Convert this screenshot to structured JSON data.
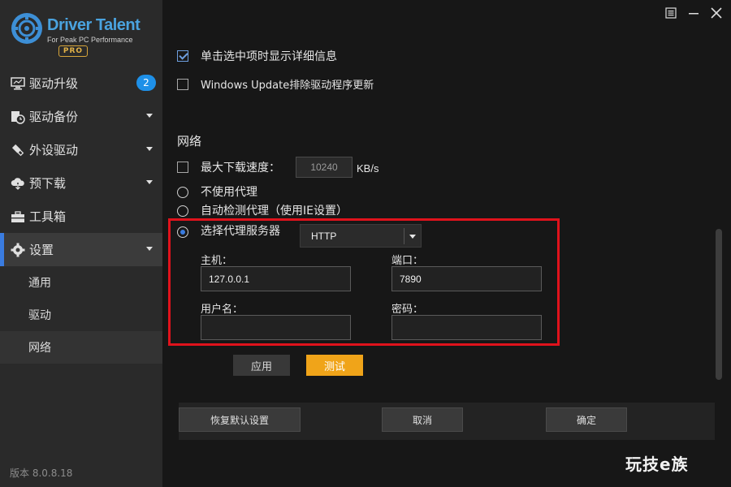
{
  "app": {
    "brand": "Driver Talent",
    "tagline": "For Peak PC Performance",
    "edition": "PRO",
    "version_label": "版本 8.0.8.18"
  },
  "sidebar": {
    "items": [
      {
        "label": "驱动升级",
        "icon": "monitor-icon",
        "badge": "2"
      },
      {
        "label": "驱动备份",
        "icon": "backup-clock-icon"
      },
      {
        "label": "外设驱动",
        "icon": "usb-icon"
      },
      {
        "label": "预下载",
        "icon": "cloud-download-icon"
      },
      {
        "label": "工具箱",
        "icon": "toolbox-icon"
      },
      {
        "label": "设置",
        "icon": "gear-icon",
        "active": true
      }
    ],
    "sub_items": [
      {
        "label": "通用"
      },
      {
        "label": "驱动"
      },
      {
        "label": "网络",
        "active": true
      }
    ]
  },
  "window_controls": {
    "menu_icon": "menu-icon",
    "minimize_icon": "minimize-icon",
    "close_icon": "close-icon"
  },
  "general_options": {
    "single_click_detail": {
      "label": "单击选中项时显示详细信息",
      "checked": true
    },
    "windows_update_exclude": {
      "label": "Windows Update排除驱动程序更新",
      "checked": false
    }
  },
  "network": {
    "section_title": "网络",
    "max_speed": {
      "label": "最大下载速度：",
      "value": "10240",
      "unit": "KB/s",
      "checked": false
    },
    "proxy_options": [
      {
        "label": "不使用代理",
        "selected": false
      },
      {
        "label": "自动检测代理（使用IE设置）",
        "selected": false
      },
      {
        "label": "选择代理服务器",
        "selected": true
      }
    ],
    "proxy_type": "HTTP",
    "host": {
      "label": "主机：",
      "value": "127.0.0.1"
    },
    "port": {
      "label": "端口：",
      "value": "7890"
    },
    "username": {
      "label": "用户名：",
      "value": ""
    },
    "password": {
      "label": "密码：",
      "value": ""
    },
    "apply_label": "应用",
    "test_label": "测试"
  },
  "footer": {
    "restore_defaults": "恢复默认设置",
    "cancel": "取消",
    "ok": "确定"
  },
  "watermark": "玩技e族",
  "colors": {
    "accent_blue": "#3a7ce0",
    "badge_blue": "#1e90e8",
    "test_orange": "#f0a419",
    "highlight_red": "#e0121c",
    "pro_gold": "#d7a53a"
  }
}
